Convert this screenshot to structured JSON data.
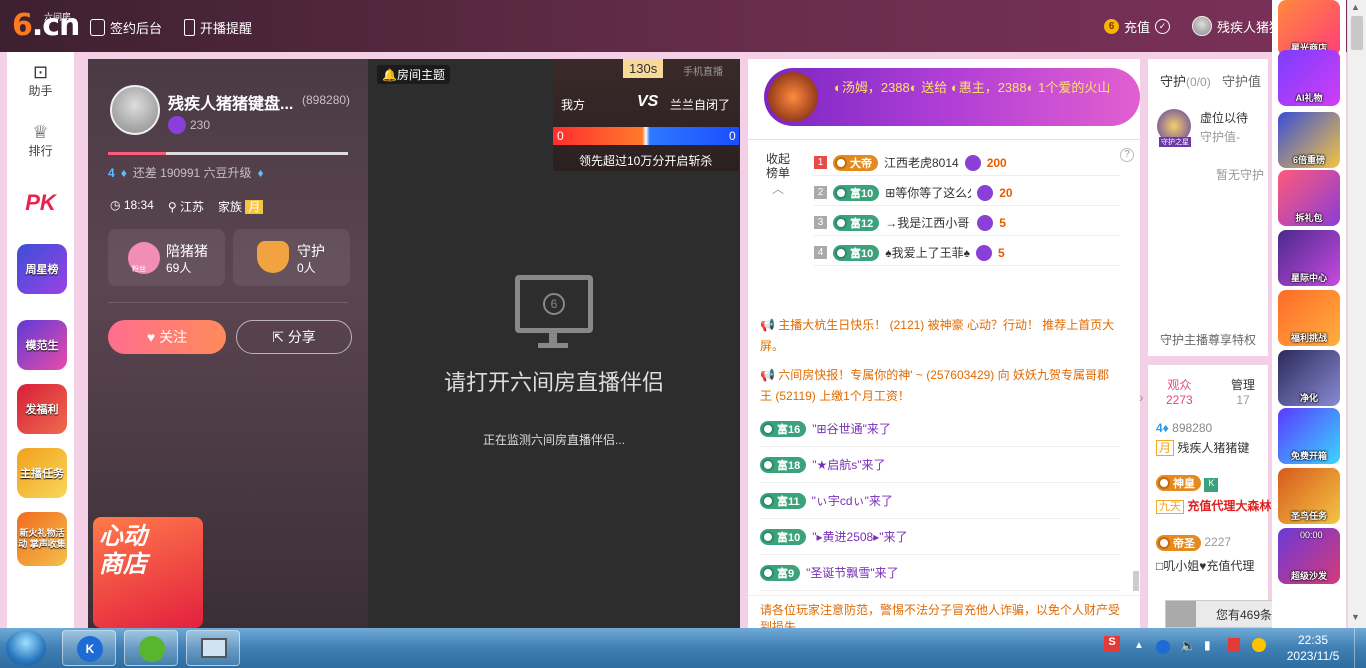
{
  "header": {
    "logo_main": "6.cn",
    "logo_sub": "六间房",
    "sign_console": "签约后台",
    "live_reminder": "开播提醒",
    "recharge": "充值",
    "username": "残疾人猪猪"
  },
  "left_rail": {
    "assistant": "助手",
    "ranking": "排行",
    "pk": "PK",
    "star_list": "周星榜",
    "model_student": "模范生",
    "red_packet": "发福利",
    "host_task": "主播任务",
    "new_gift": "新火礼物活动 掌声收集"
  },
  "profile": {
    "name": "残疾人猪猪键盘...",
    "room_id": "(898280)",
    "charm": "230",
    "level_text": "还差 190991 六豆升级",
    "level_from": "4",
    "time": "18:34",
    "location": "江苏",
    "family_label": "家族",
    "family_tag": "月",
    "fans_name": "陪猪猪",
    "fans_count": "69人",
    "fans_badge": "粉丝",
    "guard_name": "守护",
    "guard_count": "0人",
    "follow_btn": "关注",
    "share_btn": "分享",
    "shop_title": "心动商店"
  },
  "stage": {
    "room_topic": "房间主题",
    "pk_timer": "130s",
    "pk_tag": "手机直播",
    "my_side": "我方",
    "vs": "VS",
    "opponent": "兰兰自闭了",
    "my_score": "0",
    "opp_score": "0",
    "pk_rule": "领先超过10万分开启斩杀",
    "placeholder_title": "请打开六间房直播伴侣",
    "placeholder_sub": "正在监测六间房直播伴侣..."
  },
  "banner": {
    "text": "◐汤姆，2388◐ 送给 ◐惠主，2388◐ 1个爱的火山"
  },
  "rank": {
    "collapse_label": "收起榜单",
    "rows": [
      {
        "no": "1",
        "level": "大帝",
        "name": "江西老虎8014",
        "score": "200"
      },
      {
        "no": "2",
        "level": "富10",
        "name": "⊞等你等了这么久|",
        "score": "20"
      },
      {
        "no": "3",
        "level": "富12",
        "name": "→我是江西小哥→",
        "score": "5"
      },
      {
        "no": "4",
        "level": "富10",
        "name": "♠我爱上了王菲♠",
        "score": "5"
      }
    ]
  },
  "chat": {
    "notices": [
      "主播大杭生日快乐！ (2121) 被神豪 心动？行动！ 推荐上首页大屏。",
      "六间房快报！专属你的神' ~ (257603429) 向 妖妖九贺专属哥郡王 (52119) 上缴1个月工资！"
    ],
    "entries": [
      {
        "level": "富16",
        "name": "\"⊞谷世通\"来了"
      },
      {
        "level": "富18",
        "name": "\"★启航s\"来了"
      },
      {
        "level": "富11",
        "name": "\"ぃ宇cdぃ\"来了"
      },
      {
        "level": "富10",
        "name": "\"▸黄进2508▸\"来了"
      },
      {
        "level": "富9",
        "name": "\"圣诞节飘雪\"来了"
      }
    ],
    "warning": "请各位玩家注意防范，警惕不法分子冒充他人诈骗，以免个人财产受到损失"
  },
  "guard": {
    "tab_guard": "守护",
    "guard_count": "(0/0)",
    "tab_value": "守护值",
    "empty_seat": "虚位以待",
    "guard_value_label": "守护值-",
    "badge": "守护之星",
    "none": "暂无守护",
    "privilege": "守护主播尊享特权"
  },
  "audience": {
    "tab_audience": "观众",
    "audience_count": "2273",
    "tab_manage": "管理",
    "manage_count": "17",
    "host_id": "898280",
    "host_name": "残疾人猪猪键",
    "host_family": "月",
    "user1_badge": "神皇",
    "user1_tag": "九天",
    "user1_name": "充值代理大森林",
    "user2_badge": "帝圣",
    "user2_id": "2227",
    "user2_name": "□叽小姐♥充值代理",
    "unread_text": "您有469条未读消息",
    "unread_count": "469"
  },
  "right_bar": {
    "items": [
      "星光商店",
      "AI礼物",
      "6倍重磅",
      "拆礼包",
      "星际中心",
      "福利挑战",
      "净化",
      "免费开箱",
      "圣鸟任务",
      "超级沙发"
    ],
    "sofa_timer": "00:00"
  },
  "taskbar": {
    "time": "22:35",
    "date": "2023/11/5"
  }
}
